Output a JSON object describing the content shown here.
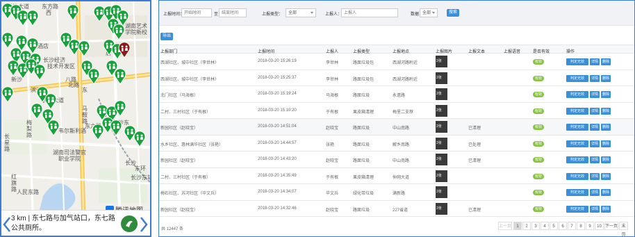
{
  "map": {
    "places": [
      {
        "name": "长沙大道",
        "cls": ""
      },
      {
        "name": "东方路",
        "cls": ""
      },
      {
        "name": "西",
        "cls": ""
      },
      {
        "name": "湖南艺术",
        "cls": ""
      },
      {
        "name": "学院新校",
        "cls": ""
      },
      {
        "name": "人酒店",
        "cls": ""
      },
      {
        "name": "居",
        "cls": ""
      },
      {
        "name": "长沙经济",
        "cls": ""
      },
      {
        "name": "技术开发区",
        "cls": ""
      },
      {
        "name": "新沙",
        "cls": ""
      },
      {
        "name": "滨江",
        "cls": ""
      },
      {
        "name": "长沙大道",
        "cls": ""
      },
      {
        "name": "东",
        "cls": ""
      },
      {
        "name": "八路",
        "cls": ""
      },
      {
        "name": "韦尔斯利酒",
        "cls": ""
      },
      {
        "name": "东六路",
        "cls": ""
      },
      {
        "name": "长沙东",
        "cls": ""
      },
      {
        "name": "湖南司法警官",
        "cls": ""
      },
      {
        "name": "职业学院",
        "cls": ""
      },
      {
        "name": "长沙",
        "cls": ""
      },
      {
        "name": "东环",
        "cls": ""
      },
      {
        "name": "长沙东站",
        "cls": ""
      },
      {
        "name": "人民东路",
        "cls": ""
      },
      {
        "name": "红",
        "cls": ""
      },
      {
        "name": "旗",
        "cls": ""
      },
      {
        "name": "路",
        "cls": ""
      },
      {
        "name": "长",
        "cls": ""
      },
      {
        "name": "星",
        "cls": ""
      },
      {
        "name": "路",
        "cls": ""
      },
      {
        "name": "马",
        "cls": ""
      },
      {
        "name": "鞍",
        "cls": ""
      },
      {
        "name": "路",
        "cls": ""
      },
      {
        "name": "北路",
        "cls": ""
      },
      {
        "name": "梅",
        "cls": ""
      },
      {
        "name": "梨",
        "cls": ""
      },
      {
        "name": "路",
        "cls": ""
      }
    ],
    "info_text": "3 km | 东七路与加气站口，东七路公共厕所。",
    "watermark": "腾讯地图"
  },
  "filters": {
    "report_time_label": "上报时间：",
    "start_placeholder": "开始时间",
    "to_label": "至",
    "end_placeholder": "结束时间",
    "report_type_label": "上报类型：",
    "report_type_value": "全部",
    "reporter_label": "上报人：",
    "reporter_placeholder": "上报人",
    "valid_label": "数据：",
    "valid_value": "全部",
    "search_label": "搜索",
    "export_label": "导出"
  },
  "table": {
    "headers": [
      "上报部门",
      "上报时间",
      "上报人",
      "上报类型",
      "上报地点",
      "上报图片",
      "上报文本",
      "上报语音",
      "是否有效",
      "操作"
    ],
    "rows": [
      {
        "dept": "西湖社区、城中社区（李世林）",
        "time": "2018-03-20 15:26:19",
        "person": "李世林",
        "type": "路面垃圾包",
        "place": "西湖河路附近",
        "img": "2张",
        "text": "",
        "valid": "有效"
      },
      {
        "dept": "西湖社区、城中社区（李世林）",
        "time": "2018-03-20 15:25:37",
        "person": "李世林",
        "type": "路面垃圾包",
        "place": "西湖河路附近",
        "img": "2张",
        "text": "",
        "valid": "有效"
      },
      {
        "dept": "北门社区（马海根）",
        "time": "2018-03-20 15:19:24",
        "person": "马海根",
        "type": "路面垃圾",
        "place": "永遗路",
        "img": "2张",
        "text": "",
        "valid": "有效"
      },
      {
        "dept": "二村、三村社区（于有根）",
        "time": "2018-03-20 15:10:20",
        "person": "于有根",
        "type": "果皮箱清理",
        "place": "梅里二支荐",
        "img": "2张",
        "text": "",
        "valid": "有效"
      },
      {
        "dept": "新园社区（赵晓宝）",
        "time": "2018-03-20 14:51:04",
        "person": "赵晓宝",
        "type": "路面垃圾",
        "place": "中山南路",
        "img": "2张",
        "text": "已清理",
        "valid": "有效"
      },
      {
        "dept": "水乡社区、惠林满华社区（张艳）",
        "time": "2018-03-20 14:44:57",
        "person": "张艳",
        "type": "路面垃圾",
        "place": "解乡南路",
        "img": "2张",
        "text": "已处理",
        "valid": "有效"
      },
      {
        "dept": "新园社区（赵晓宝）",
        "time": "2018-03-20 14:43:20",
        "person": "赵晓宝",
        "type": "路面垃圾",
        "place": "中山南路",
        "img": "2张",
        "text": "已清理",
        "valid": "有效"
      },
      {
        "dept": "二村、三村社区（于有根）",
        "time": "2018-03-20 14:35:49",
        "person": "于有根",
        "type": "果皮箱清理",
        "place": "仲网大道",
        "img": "2张",
        "text": "",
        "valid": "有效"
      },
      {
        "dept": "梅石社区、苏河社区（毕文兵）",
        "time": "2018-03-20 14:34:07",
        "person": "毕文兵",
        "type": "绿化带垃圾",
        "place": "满新路",
        "img": "2张",
        "text": "",
        "valid": "有效"
      },
      {
        "dept": "新园社区（赵晓宝）",
        "time": "2018-03-20 14:32:46",
        "person": "赵晓宝",
        "type": "路面垃圾",
        "place": "227省道",
        "img": "2张",
        "text": "已清理",
        "valid": "有效"
      }
    ],
    "actions": [
      "判定无效",
      "详情",
      "删除"
    ]
  },
  "footer": {
    "total": "共 12447 条",
    "pages": [
      "1",
      "2",
      "3",
      "4",
      "5",
      "6",
      "7",
      "8",
      "9",
      "10",
      "下一页",
      "末页"
    ],
    "prev_label": "上一页"
  },
  "colors": {
    "accent": "#3a8fd9",
    "badge": "#8bc34a",
    "pin_green": "#1aa03c",
    "pin_red": "#8b1a1a"
  }
}
